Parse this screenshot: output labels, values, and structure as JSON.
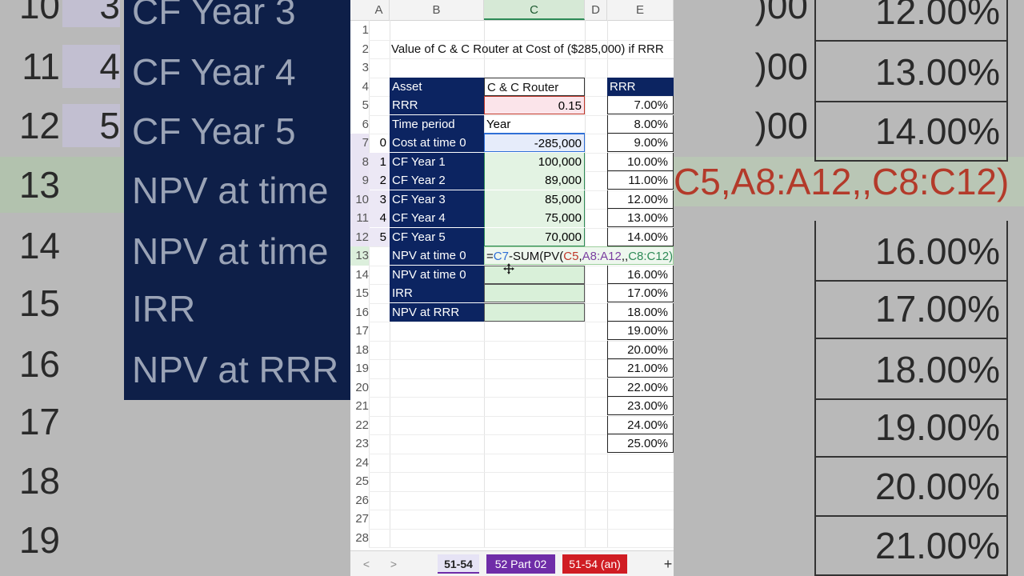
{
  "background": {
    "left_rows": [
      {
        "row": "10",
        "num": "3",
        "label": "CF Year 3"
      },
      {
        "row": "11",
        "num": "4",
        "label": "CF Year 4"
      },
      {
        "row": "12",
        "num": "5",
        "label": "CF Year 5"
      },
      {
        "row": "13",
        "num": "",
        "label": "NPV at time"
      },
      {
        "row": "14",
        "num": "",
        "label": "NPV at time"
      },
      {
        "row": "15",
        "num": "",
        "label": "IRR"
      },
      {
        "row": "16",
        "num": "",
        "label": "NPV at RRR"
      },
      {
        "row": "17",
        "num": "",
        "label": ""
      },
      {
        "row": "18",
        "num": "",
        "label": ""
      },
      {
        "row": "19",
        "num": "",
        "label": ""
      }
    ],
    "right_rows": [
      "12.00%",
      "13.00%",
      "14.00%",
      "",
      "16.00%",
      "17.00%",
      "18.00%",
      "19.00%",
      "20.00%",
      "21.00%"
    ],
    "right_stub": [
      ")00",
      ")00",
      ")00"
    ],
    "right_formula": "C5,A8:A12,,C8:C12)"
  },
  "sheet": {
    "columns": [
      "A",
      "B",
      "C",
      "D",
      "E"
    ],
    "row_numbers": [
      "1",
      "2",
      "3",
      "4",
      "5",
      "6",
      "7",
      "8",
      "9",
      "10",
      "11",
      "12",
      "13",
      "14",
      "15",
      "16",
      "17",
      "18",
      "19",
      "20",
      "21",
      "22",
      "23",
      "24",
      "25",
      "26",
      "27",
      "28"
    ],
    "title": "Value of C & C Router at Cost of ($285,000) if RRR",
    "table": [
      {
        "a": "",
        "label": "Asset",
        "value": "C & C Router"
      },
      {
        "a": "",
        "label": "RRR",
        "value": "0.15"
      },
      {
        "a": "",
        "label": "Time period",
        "value": "Year"
      },
      {
        "a": "0",
        "label": "Cost at time 0",
        "value": "-285,000"
      },
      {
        "a": "1",
        "label": "CF Year 1",
        "value": "100,000"
      },
      {
        "a": "2",
        "label": "CF Year 2",
        "value": "89,000"
      },
      {
        "a": "3",
        "label": "CF Year 3",
        "value": "85,000"
      },
      {
        "a": "4",
        "label": "CF Year 4",
        "value": "75,000"
      },
      {
        "a": "5",
        "label": "CF Year 5",
        "value": "70,000"
      },
      {
        "a": "",
        "label": "NPV at time 0",
        "value": ""
      },
      {
        "a": "",
        "label": "NPV at time 0",
        "value": ""
      },
      {
        "a": "",
        "label": "IRR",
        "value": ""
      },
      {
        "a": "",
        "label": "NPV at RRR",
        "value": ""
      }
    ],
    "formula": {
      "prefix": "=",
      "ref1": "C7",
      "mid": "-SUM(PV(",
      "ref2": "C5",
      "comma": ",",
      "ref3": "A8:A12",
      "commas": ",,",
      "ref4": "C8:C12)"
    },
    "rrr_header": "RRR",
    "rrr_values": [
      "7.00%",
      "8.00%",
      "9.00%",
      "10.00%",
      "11.00%",
      "12.00%",
      "13.00%",
      "14.00%",
      "",
      "16.00%",
      "17.00%",
      "18.00%",
      "19.00%",
      "20.00%",
      "21.00%",
      "22.00%",
      "23.00%",
      "24.00%",
      "25.00%"
    ]
  },
  "tabs": {
    "prev": "<",
    "next": ">",
    "items": [
      "51-54",
      "52 Part 02",
      "51-54 (an)"
    ],
    "add": "+"
  },
  "colors": {
    "navy": "#0c2461",
    "tab_active": "#e6e3f5",
    "tab_purple": "#6f2da8",
    "tab_red": "#d01d23",
    "ref_blue": "#2f6fd6",
    "ref_red": "#c0392b",
    "ref_purple": "#7b3fa0",
    "ref_green": "#2e8b57"
  }
}
